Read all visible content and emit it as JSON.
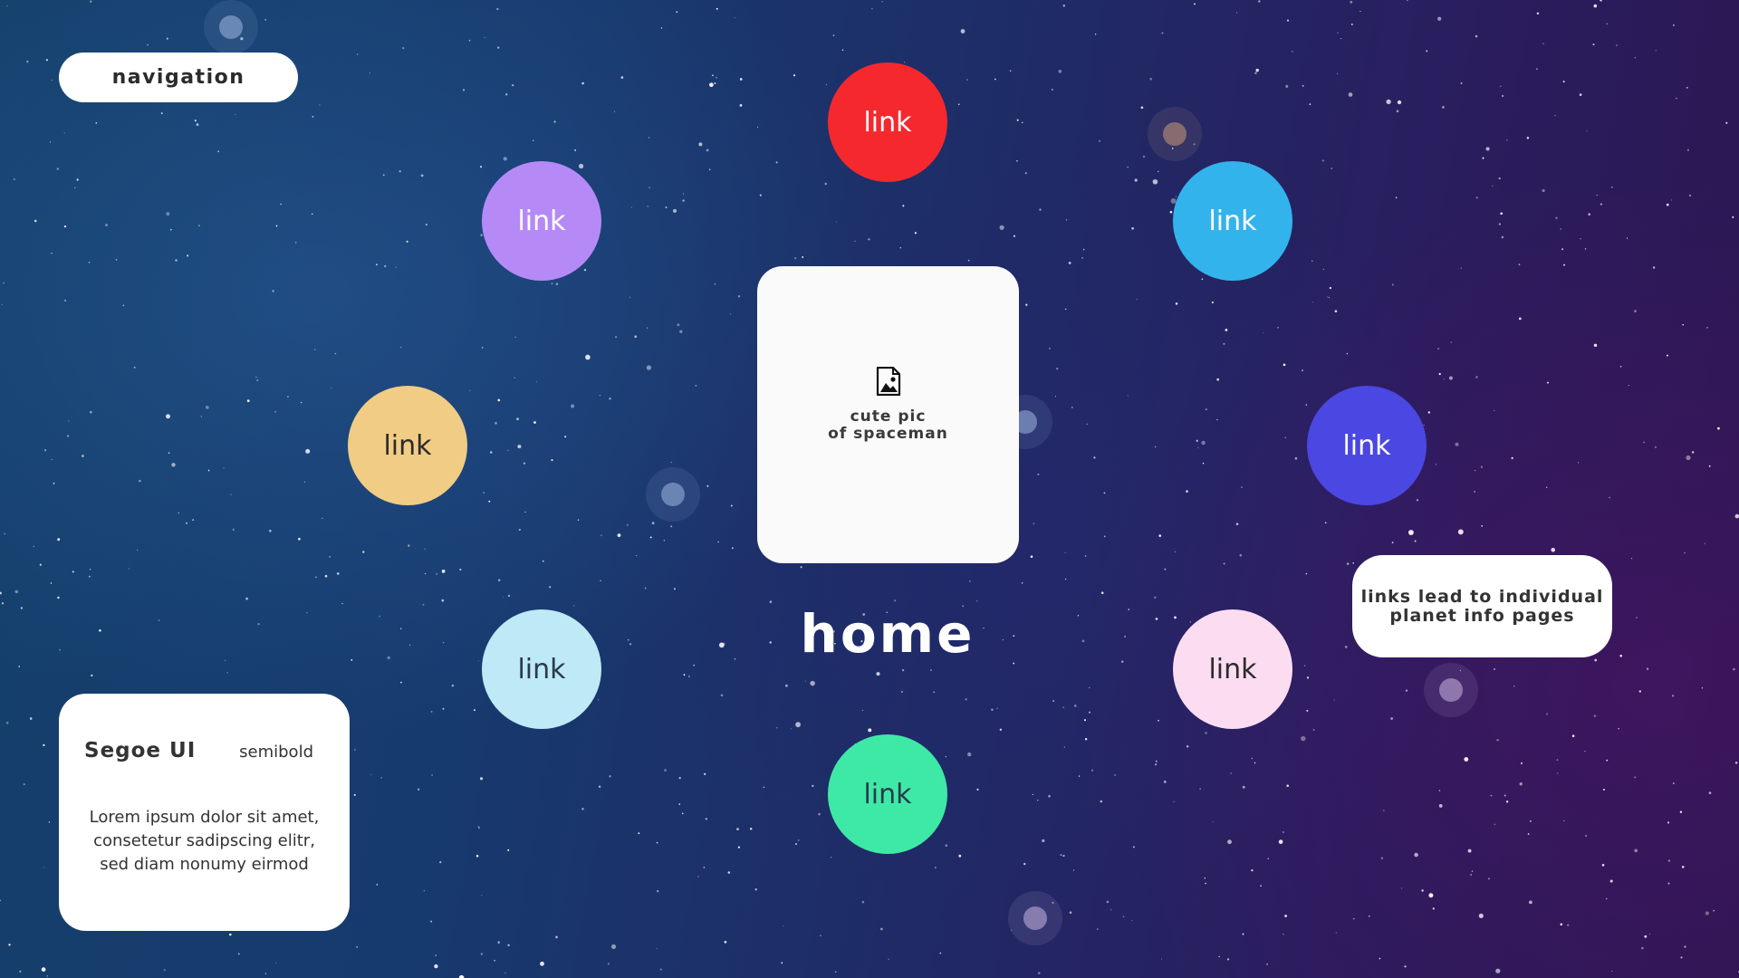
{
  "navigation": {
    "label": "navigation"
  },
  "center": {
    "image_caption": [
      "cute pic",
      "of spaceman"
    ],
    "title": "home"
  },
  "links": [
    {
      "label": "link",
      "color": "#f5282d",
      "text_color": "#ffffff"
    },
    {
      "label": "link",
      "color": "#b58af7",
      "text_color": "#ffffff"
    },
    {
      "label": "link",
      "color": "#33b3ec",
      "text_color": "#ffffff"
    },
    {
      "label": "link",
      "color": "#f1cc84",
      "text_color": "#2b2b2b"
    },
    {
      "label": "link",
      "color": "#4a47e2",
      "text_color": "#ffffff"
    },
    {
      "label": "link",
      "color": "#bee9f6",
      "text_color": "#2b3a4a"
    },
    {
      "label": "link",
      "color": "#fbdcf1",
      "text_color": "#2b2b2b"
    },
    {
      "label": "link",
      "color": "#3ee9a6",
      "text_color": "#2b3a4a"
    }
  ],
  "note": {
    "lines": [
      "links lead to individual",
      "planet info pages"
    ]
  },
  "font_card": {
    "font_name": "Segoe UI",
    "font_weight": "semibold",
    "sample_lines": [
      "Lorem ipsum dolor sit amet,",
      "consetetur sadipscing elitr,",
      "sed diam nonumy eirmod"
    ]
  },
  "icons": {
    "image_placeholder": "image-file-icon"
  }
}
